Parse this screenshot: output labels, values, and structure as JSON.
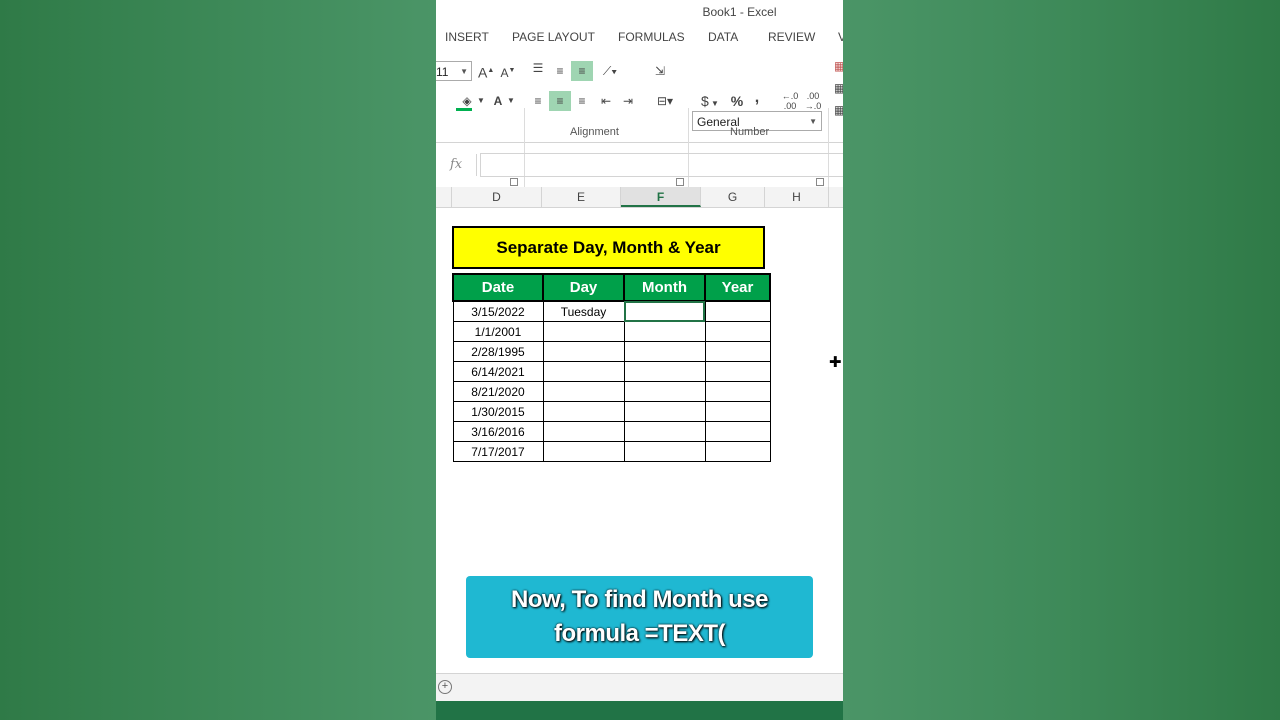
{
  "window": {
    "title": "Book1 - Excel"
  },
  "tabs": [
    "INSERT",
    "PAGE LAYOUT",
    "FORMULAS",
    "DATA",
    "REVIEW",
    "V"
  ],
  "ribbon": {
    "font_size": "11",
    "number_format": "General",
    "groups": {
      "alignment": "Alignment",
      "number": "Number"
    },
    "number_buttons": {
      "currency": "$",
      "percent": "%",
      "comma": ","
    },
    "font_grow": "A",
    "font_shrink": "A",
    "font_color": "A",
    "increase_decimal": "←.0 .00",
    "decrease_decimal": ".00 →.0"
  },
  "formula_bar": {
    "fx_label": "fx",
    "value": ""
  },
  "columns": [
    "D",
    "E",
    "F",
    "G",
    "H"
  ],
  "active_column": "F",
  "sheet_title": "Separate Day, Month & Year",
  "table": {
    "headers": [
      "Date",
      "Day",
      "Month",
      "Year"
    ],
    "rows": [
      [
        "3/15/2022",
        "Tuesday",
        "",
        ""
      ],
      [
        "1/1/2001",
        "",
        "",
        ""
      ],
      [
        "2/28/1995",
        "",
        "",
        ""
      ],
      [
        "6/14/2021",
        "",
        "",
        ""
      ],
      [
        "8/21/2020",
        "",
        "",
        ""
      ],
      [
        "1/30/2015",
        "",
        "",
        ""
      ],
      [
        "3/16/2016",
        "",
        "",
        ""
      ],
      [
        "7/17/2017",
        "",
        "",
        ""
      ]
    ]
  },
  "caption": {
    "line1": "Now, To find Month use",
    "line2": "formula =TEXT("
  },
  "colors": {
    "header_green": "#00a04a",
    "title_yellow": "#ffff00",
    "caption_cyan": "#1fb8d2",
    "excel_green": "#217346"
  }
}
